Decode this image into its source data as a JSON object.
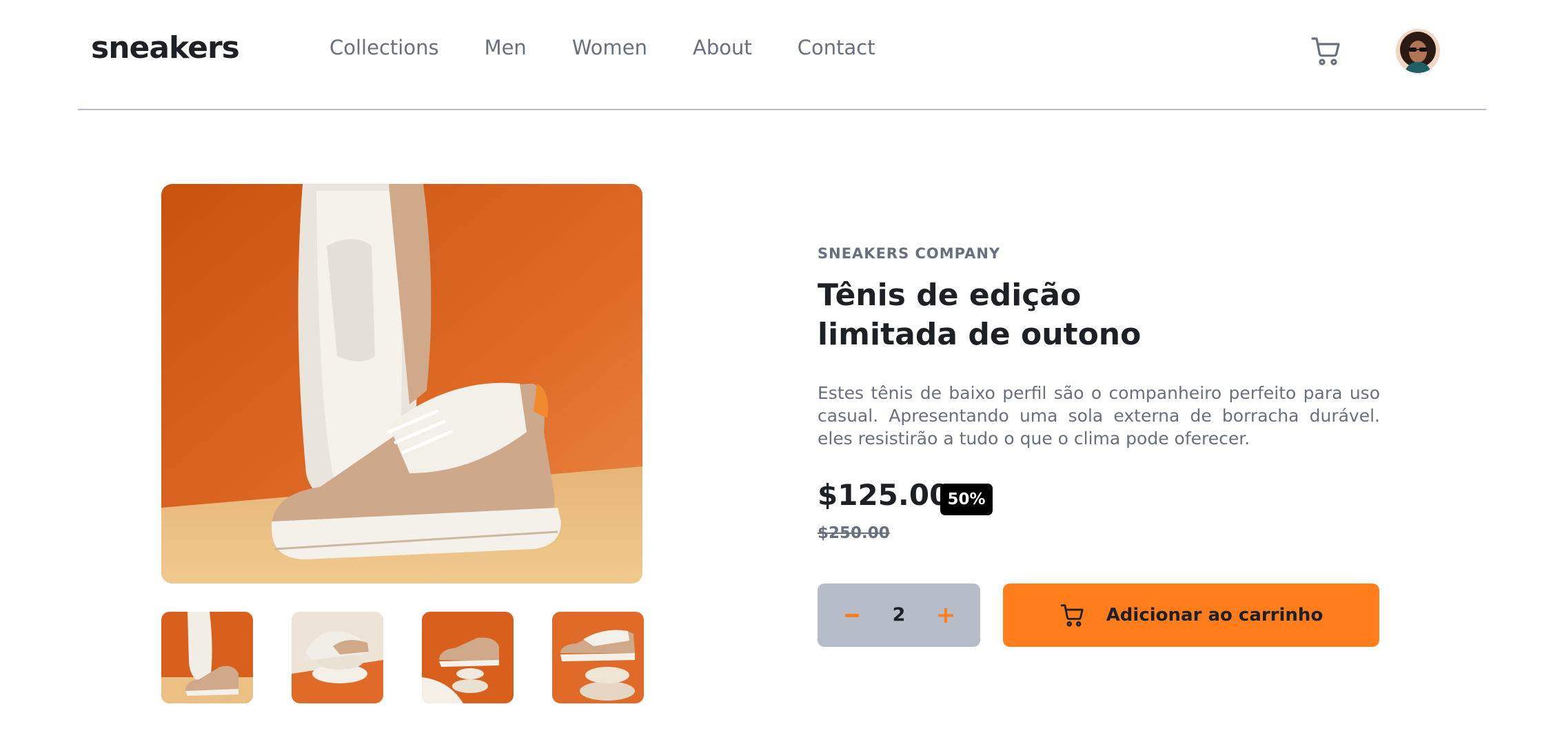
{
  "header": {
    "logo": "sneakers",
    "nav": [
      "Collections",
      "Men",
      "Women",
      "About",
      "Contact"
    ]
  },
  "product": {
    "company": "SNEAKERS COMPANY",
    "title_line1": "Tênis de edição",
    "title_line2": "limitada de outono",
    "description": "Estes tênis de baixo perfil são o companheiro perfeito para uso casual. Apresentando uma sola externa de borracha durável. eles resistirão a tudo o que o clima pode oferecer.",
    "price": "$125.00",
    "discount": "50%",
    "old_price": "$250.00"
  },
  "cart": {
    "quantity": "2",
    "add_label": "Adicionar ao carrinho"
  },
  "icons": {
    "cart": "cart-icon",
    "minus": "minus-icon",
    "plus": "plus-icon"
  },
  "colors": {
    "accent": "#ff7e1b",
    "text_dark": "#1d2025",
    "text_muted": "#69707d",
    "divider": "#b6bcc8",
    "image_bg": "#e06a28",
    "floor": "#e8b97a"
  }
}
